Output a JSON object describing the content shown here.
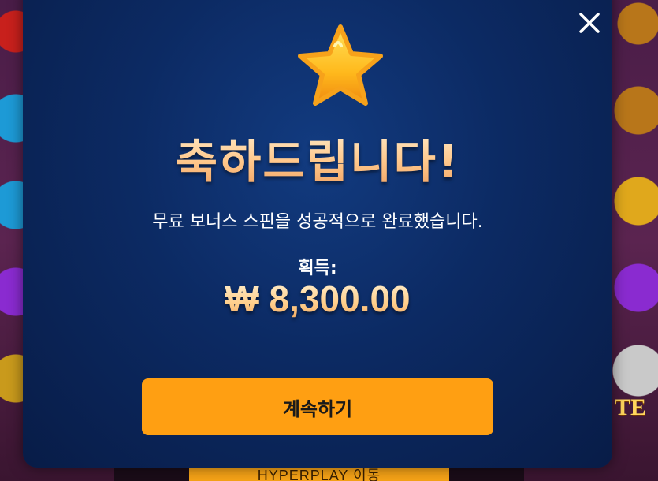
{
  "background": {
    "hyperplay_button_label": "HYPERPLAY 이동",
    "side_text": "TE"
  },
  "modal": {
    "close_icon": "close-icon",
    "star_icon": "star-icon",
    "title": "축하드립니다!",
    "subtitle": "무료 보너스 스핀을 성공적으로 완료했습니다.",
    "win_label": "획득:",
    "win_amount": "₩ 8,300.00",
    "continue_label": "계속하기"
  },
  "colors": {
    "modal_bg": "#0c2a63",
    "button_bg": "#ff9f12",
    "title_gold": "#ffc88c"
  }
}
